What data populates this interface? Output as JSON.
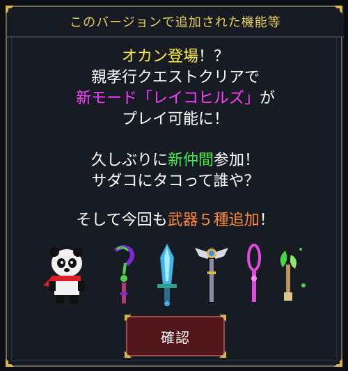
{
  "dialog": {
    "title": "このバージョンで追加された機能等",
    "lines": {
      "l1a": "オカン登場",
      "l1b": "！？",
      "l2": "親孝行クエストクリアで",
      "l3a": "新モード「レイコヒルズ」",
      "l3b": "が",
      "l4": "プレイ可能に！",
      "l5a": "久しぶりに",
      "l5b": "新仲間",
      "l5c": "参加！",
      "l6": "サダコにタコって誰や？",
      "l7a": "そして今回も",
      "l7b": "武器５種追加",
      "l7c": "！"
    },
    "items": [
      "panda-icon",
      "curved-staff-icon",
      "crystal-sword-icon",
      "winged-staff-icon",
      "ring-wand-icon",
      "leaf-wand-icon"
    ],
    "confirm_label": "確認"
  },
  "colors": {
    "background": "#171b24",
    "title": "#e7cf59",
    "highlight_yellow": "#fff24a",
    "highlight_magenta": "#ff3fff",
    "highlight_green": "#44f04c",
    "highlight_orange": "#ff8a3d",
    "button": "#52151a"
  }
}
